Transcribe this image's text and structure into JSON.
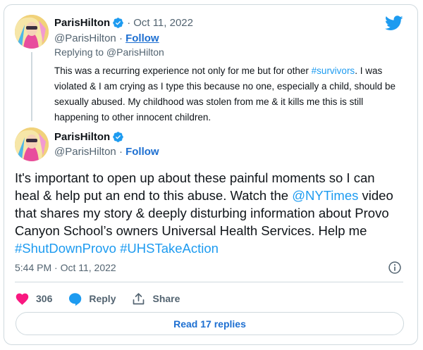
{
  "colors": {
    "accent": "#1d9bf0",
    "text": "#0f1419",
    "muted": "#536471",
    "like": "#f91880",
    "border": "#cfd9de"
  },
  "reply_tweet": {
    "display_name": "ParisHilton",
    "date": "Oct 11, 2022",
    "handle": "@ParisHilton",
    "follow_label": "Follow",
    "replying_to": "Replying to @ParisHilton",
    "text_parts": [
      "This was a recurring experience not only for me but for other ",
      "#survivors",
      ". I was violated & I am crying as I type this because no one, especially a child, should be sexually abused. My childhood was stolen from me & it kills me this is still happening to other innocent children."
    ]
  },
  "main_tweet": {
    "display_name": "ParisHilton",
    "handle": "@ParisHilton",
    "follow_label": "Follow",
    "text_parts": [
      "It's important to open up about these painful moments so I can heal & help put an end to this abuse. Watch the ",
      "@NYTimes",
      " video that shares my story & deeply disturbing information about Provo Canyon School’s owners Universal Health Services. Help me ",
      "#ShutDownProvo",
      " ",
      "#UHSTakeAction"
    ],
    "timestamp": "5:44 PM · Oct 11, 2022",
    "like_count": "306",
    "reply_label": "Reply",
    "share_label": "Share",
    "read_replies_label": "Read 17 replies"
  },
  "icons": {
    "logo": "twitter-bird-icon",
    "verified": "verified-badge-icon",
    "info": "info-icon",
    "like": "heart-icon",
    "reply": "speech-bubble-icon",
    "share": "share-upload-icon"
  }
}
